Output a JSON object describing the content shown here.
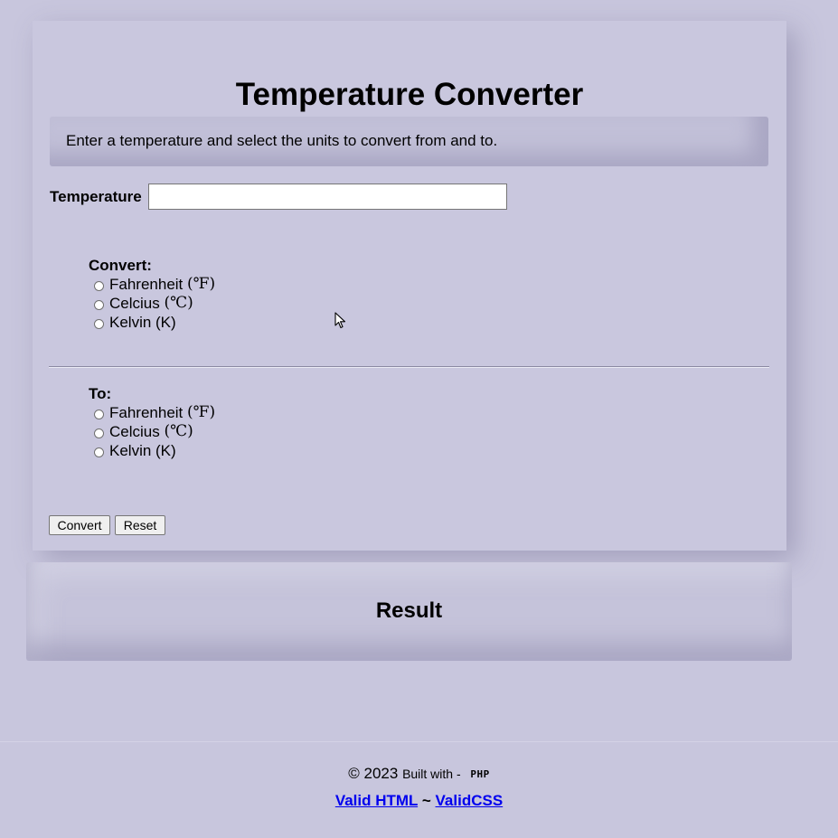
{
  "header": {
    "title": "Temperature Converter",
    "intro": "Enter a temperature and select the units to convert from and to."
  },
  "form": {
    "temperature_label": "Temperature",
    "temperature_value": "",
    "temperature_placeholder": "",
    "convert_from": {
      "label": "Convert:",
      "options": [
        {
          "name": "Fahrenheit",
          "symbol": "(℉)"
        },
        {
          "name": "Celcius",
          "symbol": "(℃)"
        },
        {
          "name": "Kelvin (K)",
          "symbol": ""
        }
      ]
    },
    "convert_to": {
      "label": "To:",
      "options": [
        {
          "name": "Fahrenheit",
          "symbol": "(℉)"
        },
        {
          "name": "Celcius",
          "symbol": "(℃)"
        },
        {
          "name": "Kelvin (K)",
          "symbol": ""
        }
      ]
    },
    "convert_button": "Convert",
    "reset_button": "Reset"
  },
  "result": {
    "title": "Result"
  },
  "footer": {
    "copyright": "© 2023",
    "built_with": "Built with -",
    "php_logo": "PHP",
    "separator": "~",
    "valid_html_link": "Valid HTML",
    "valid_css_link": "ValidCSS"
  },
  "colors": {
    "background": "#c8c6dd",
    "link": "#0000ee"
  }
}
